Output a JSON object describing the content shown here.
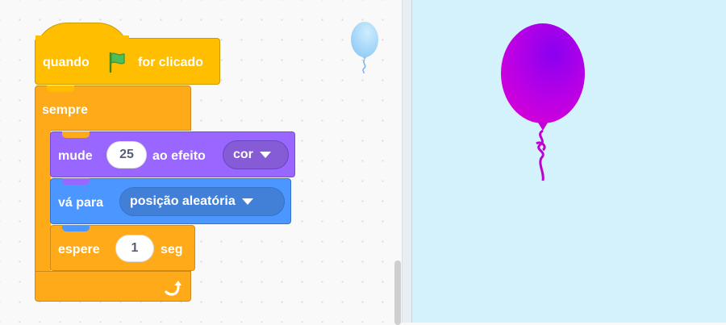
{
  "code_area": {
    "hat_block": {
      "prefix": "quando",
      "flag_icon": "green-flag-icon",
      "suffix": "for clicado"
    },
    "forever_block": {
      "label": "sempre",
      "loop_icon": "loop-arrow-icon"
    },
    "change_effect_block": {
      "prefix": "mude",
      "value": "25",
      "middle": "ao efeito",
      "dropdown": "cor"
    },
    "goto_block": {
      "prefix": "vá para",
      "dropdown": "posição aleatória"
    },
    "wait_block": {
      "prefix": "espere",
      "value": "1",
      "suffix": "seg"
    }
  },
  "stage": {
    "sprite": "balloon",
    "sprite_color": "#b000e0",
    "background": "#d3f2fc"
  },
  "colors": {
    "events": "#ffbf00",
    "control": "#ffab19",
    "looks": "#9966ff",
    "motion": "#4c97ff"
  }
}
